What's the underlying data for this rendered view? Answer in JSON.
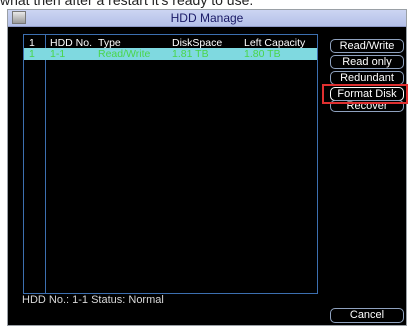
{
  "top_text": "what then after a restart it's ready to use.",
  "window": {
    "title": "HDD Manage",
    "icon": "app-icon"
  },
  "table": {
    "headers": [
      "1",
      "HDD No.",
      "Type",
      "DiskSpace",
      "Left Capacity"
    ],
    "rows": [
      [
        "1",
        "1-1",
        "Read/Write",
        "1.81 TB",
        "1.80 TB"
      ]
    ],
    "selected_row_index": 0
  },
  "buttons": {
    "read_write": "Read/Write",
    "read_only": "Read only",
    "redundant": "Redundant",
    "format_disk": "Format Disk",
    "recover": "Recover",
    "cancel": "Cancel"
  },
  "status": "HDD No.: 1-1 Status: Normal",
  "colors": {
    "highlight": "#e03030",
    "selected_row": "#7fd9e0",
    "row_text": "#4ad64a",
    "panel_border": "#3c6fb0"
  }
}
